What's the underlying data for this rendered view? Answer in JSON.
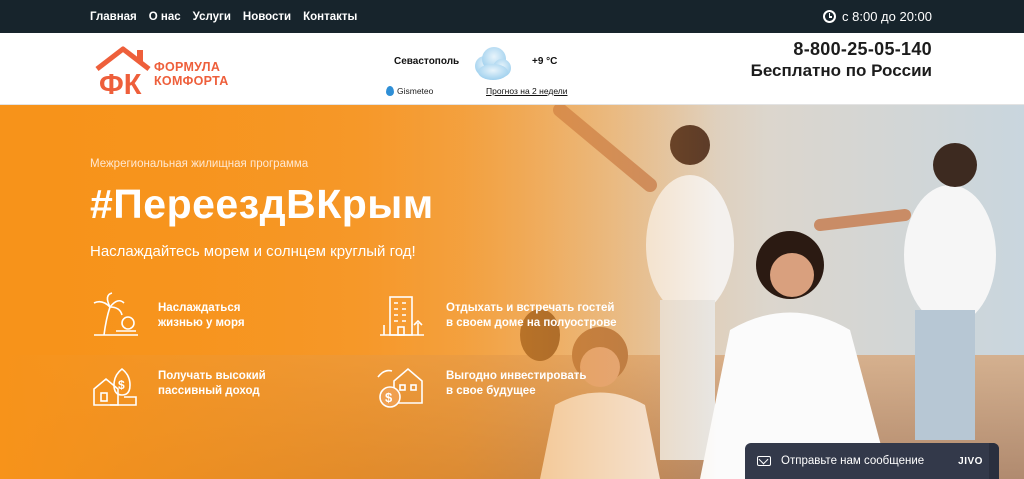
{
  "topbar": {
    "nav": [
      "Главная",
      "О нас",
      "Услуги",
      "Новости",
      "Контакты"
    ],
    "hours": "с 8:00 до 20:00"
  },
  "header": {
    "logo_mark": "ФК",
    "logo_line1": "ФОРМУЛА",
    "logo_line2": "КОМФОРТА",
    "weather": {
      "city": "Севастополь",
      "temp": "+9 °С",
      "provider": "Gismeteo",
      "forecast_link": "Прогноз на 2 недели",
      "icon": "cloud-icon"
    },
    "phone": "8-800-25-05-140",
    "phone_note": "Бесплатно по России"
  },
  "hero": {
    "tagline": "Межрегиональная жилищная программа",
    "headline": "#ПереездВКрым",
    "subtitle": "Наслаждайтесь морем и солнцем круглый год!",
    "features": [
      {
        "icon": "palm-beach-icon",
        "text_1": "Наслаждаться",
        "text_2": "жизнью у моря"
      },
      {
        "icon": "building-icon",
        "text_1": "Отдыхать и встречать гостей",
        "text_2": "в своем доме на полуострове"
      },
      {
        "icon": "house-money-icon",
        "text_1": "Получать высокий",
        "text_2": "пассивный доход"
      },
      {
        "icon": "invest-house-icon",
        "text_1": "Выгодно инвестировать",
        "text_2": "в свое будущее"
      }
    ]
  },
  "chat_widget": {
    "message": "Отправьте нам сообщение",
    "brand": "JIVO"
  },
  "colors": {
    "topbar": "#17242c",
    "brand_orange": "#ee5f3b",
    "hero_orange": "#f6941c",
    "chat_bg": "#33394a"
  }
}
